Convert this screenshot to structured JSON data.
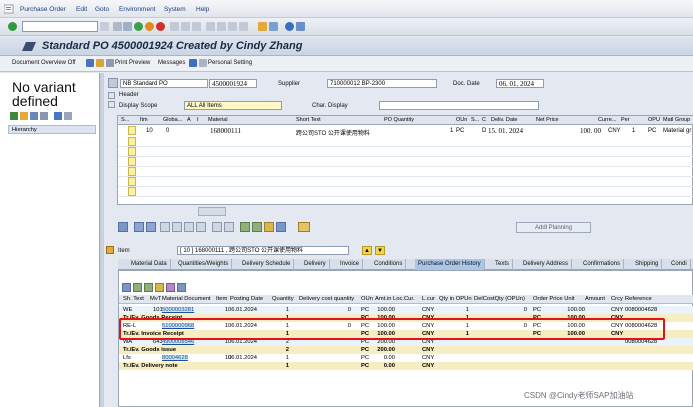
{
  "menu": {
    "items": [
      "Purchase Order",
      "Edit",
      "Goto",
      "Environment",
      "System",
      "Help"
    ]
  },
  "title": "Standard PO 4500001924 Created by Cindy Zhang",
  "app_toolbar": [
    "Document Overview Off",
    "Print Preview",
    "Messages",
    "Personal Setting"
  ],
  "left": {
    "variant_text": "No variant defined",
    "hierarchy": "Hierarchy"
  },
  "header": {
    "po_type": "NB Standard PO",
    "po_number": "4500001924",
    "supplier_label": "Supplier",
    "supplier_value": "710000012 BP-2300",
    "doc_date_label": "Doc. Date",
    "doc_date_value": "06. 01. 2024",
    "header_label": "Header",
    "display_scope_label": "Display Scope",
    "display_scope_value": "ALL All Items",
    "char_display_label": "Char. Display"
  },
  "items_grid": {
    "headers": [
      "S...",
      "Itm",
      "Globa...",
      "A",
      "I",
      "Material",
      "Short Text",
      "PO Quantity",
      "OUn",
      "S...",
      "C",
      "Deliv. Date",
      "Net Price",
      "Curre...",
      "Per",
      "OPU",
      "Matl Group"
    ],
    "row": {
      "itm": "10",
      "glob": "0",
      "material": "168000111",
      "short_text": "跨公司STO 公开课使用物料",
      "po_qty": "1",
      "oun": "PC",
      "c": "D",
      "deliv": "15. 01. 2024",
      "net_price": "100. 00",
      "curr": "CNY",
      "per": "1",
      "opu": "PC",
      "matl": "Material gr"
    }
  },
  "addl_planning": "Addl Planning",
  "item_label": "Item",
  "item_value": "[ 10 ] 168000111 , 跨公司STO 公开课使用物料",
  "tabs": [
    "Material Data",
    "Quantities/Weights",
    "Delivery Schedule",
    "Delivery",
    "Invoice",
    "Conditions",
    "Purchase Order History",
    "Texts",
    "Delivery Address",
    "Confirmations",
    "Shipping",
    "Condi"
  ],
  "history": {
    "headers": [
      "Sh. Text",
      "MvT",
      "Material Document",
      "Item",
      "Posting Date",
      "Quantity",
      "Delivery cost quantity",
      "OUn",
      "Amt.in Loc.Cur.",
      "L.cur",
      "Qty in OPUn",
      "DelCostQty (OPUn)",
      "Order Price Unit",
      "Amount",
      "Crcy",
      "Reference"
    ],
    "rows": [
      {
        "sh": "WE",
        "mvt": "101",
        "doc": "5000003281",
        "item": "1",
        "date": "06.01.2024",
        "qty": "1",
        "dcq": "0",
        "oun": "PC",
        "amt": "100.00",
        "lcur": "CNY",
        "qop": "1",
        "dco": "0",
        "opu": "PC",
        "amount": "100.00",
        "crcy": "CNY",
        "ref": "0080004628",
        "bold": false,
        "link": true
      },
      {
        "sh": "Tr./Ev. Goods Receipt",
        "mvt": "",
        "doc": "",
        "item": "",
        "date": "",
        "qty": "1",
        "dcq": "",
        "oun": "PC",
        "amt": "100.00",
        "lcur": "CNY",
        "qop": "1",
        "dco": "",
        "opu": "PC",
        "amount": "100.00",
        "crcy": "CNY",
        "ref": "",
        "bold": true,
        "link": false
      },
      {
        "sh": "RE-L",
        "mvt": "",
        "doc": "5100000968",
        "item": "1",
        "date": "06.01.2024",
        "qty": "1",
        "dcq": "0",
        "oun": "PC",
        "amt": "100.00",
        "lcur": "CNY",
        "qop": "1",
        "dco": "0",
        "opu": "PC",
        "amount": "100.00",
        "crcy": "CNY",
        "ref": "0080004628",
        "bold": false,
        "link": true
      },
      {
        "sh": "Tr./Ev. Invoice Receipt",
        "mvt": "",
        "doc": "",
        "item": "",
        "date": "",
        "qty": "1",
        "dcq": "",
        "oun": "PC",
        "amt": "100.00",
        "lcur": "CNY",
        "qop": "1",
        "dco": "",
        "opu": "PC",
        "amount": "100.00",
        "crcy": "CNY",
        "ref": "",
        "bold": true,
        "link": false
      },
      {
        "sh": "WA",
        "mvt": "643",
        "doc": "4900008546",
        "item": "1",
        "date": "06.01.2024",
        "qty": "2",
        "dcq": "",
        "oun": "PC",
        "amt": "200.00",
        "lcur": "CNY",
        "qop": "",
        "dco": "",
        "opu": "",
        "amount": "",
        "crcy": "",
        "ref": "0080004628",
        "bold": false,
        "link": true
      },
      {
        "sh": "Tr./Ev. Goods issue",
        "mvt": "",
        "doc": "",
        "item": "",
        "date": "",
        "qty": "2",
        "dcq": "",
        "oun": "PC",
        "amt": "200.00",
        "lcur": "CNY",
        "qop": "",
        "dco": "",
        "opu": "",
        "amount": "",
        "crcy": "",
        "ref": "",
        "bold": true,
        "link": false
      },
      {
        "sh": "Lfs",
        "mvt": "",
        "doc": "80004628",
        "item": "10",
        "date": "06.01.2024",
        "qty": "1",
        "dcq": "",
        "oun": "PC",
        "amt": "0.00",
        "lcur": "CNY",
        "qop": "",
        "dco": "",
        "opu": "",
        "amount": "",
        "crcy": "",
        "ref": "",
        "bold": false,
        "link": true
      },
      {
        "sh": "Tr./Ev. Delivery note",
        "mvt": "",
        "doc": "",
        "item": "",
        "date": "",
        "qty": "1",
        "dcq": "",
        "oun": "PC",
        "amt": "0.00",
        "lcur": "CNY",
        "qop": "",
        "dco": "",
        "opu": "",
        "amount": "",
        "crcy": "",
        "ref": "",
        "bold": true,
        "link": false
      }
    ]
  },
  "watermark": "CSDN @Cindy老师SAP加油站"
}
